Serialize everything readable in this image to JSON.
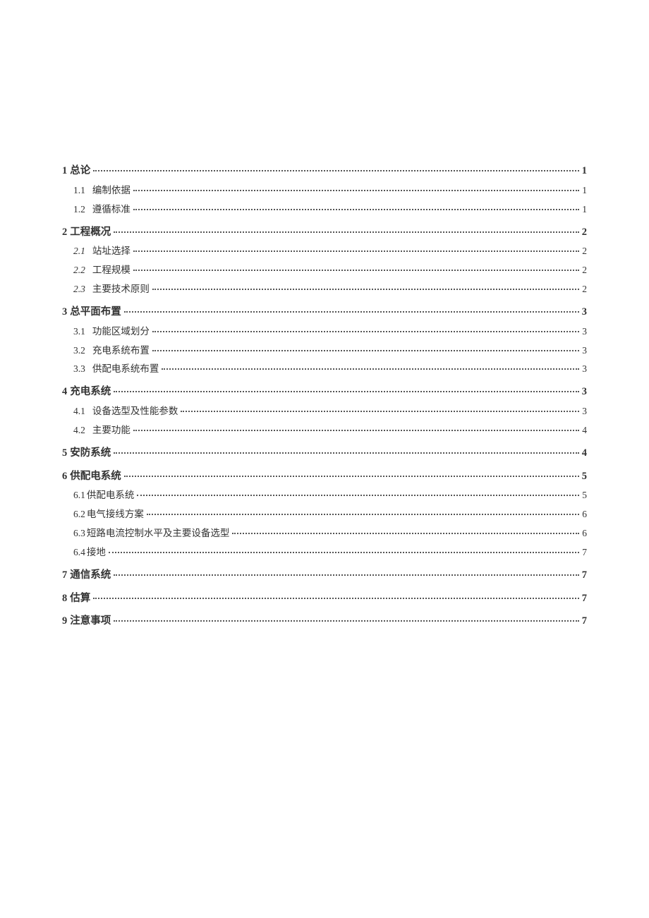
{
  "toc": [
    {
      "num": "1",
      "title": "总论",
      "page": "1",
      "level": 1,
      "children": [
        {
          "num": "1.1",
          "title": "编制依据",
          "page": "1",
          "level": 2
        },
        {
          "num": "1.2",
          "title": "遵循标准",
          "page": "1",
          "level": 2
        }
      ]
    },
    {
      "num": "2",
      "title": "工程概况",
      "page": "2",
      "level": 1,
      "children": [
        {
          "num": "2.1",
          "title": "站址选择",
          "page": "2",
          "level": 2,
          "italicNum": true
        },
        {
          "num": "2.2",
          "title": "工程规模",
          "page": "2",
          "level": 2,
          "italicNum": true
        },
        {
          "num": "2.3",
          "title": "主要技术原则",
          "page": "2",
          "level": 2,
          "italicNum": true
        }
      ]
    },
    {
      "num": "3",
      "title": "总平面布置",
      "page": "3",
      "level": 1,
      "children": [
        {
          "num": "3.1",
          "title": "功能区域划分",
          "page": "3",
          "level": 2
        },
        {
          "num": "3.2",
          "title": "充电系统布置",
          "page": "3",
          "level": 2
        },
        {
          "num": "3.3",
          "title": "供配电系统布置",
          "page": "3",
          "level": 2
        }
      ]
    },
    {
      "num": "4",
      "title": "充电系统",
      "page": "3",
      "level": 1,
      "children": [
        {
          "num": "4.1",
          "title": "设备选型及性能参数",
          "page": "3",
          "level": 2
        },
        {
          "num": "4.2",
          "title": "主要功能",
          "page": "4",
          "level": 2
        }
      ]
    },
    {
      "num": "5",
      "title": "安防系统",
      "page": "4",
      "level": 1,
      "children": []
    },
    {
      "num": "6",
      "title": "供配电系统",
      "page": "5",
      "level": 1,
      "children": [
        {
          "num": "6.1",
          "title": "供配电系统",
          "page": "5",
          "level": 2,
          "noGap": true
        },
        {
          "num": "6.2",
          "title": "电气接线方案",
          "page": "6",
          "level": 2,
          "noGap": true
        },
        {
          "num": "6.3",
          "title": "短路电流控制水平及主要设备选型",
          "page": "6",
          "level": 2,
          "noGap": true
        },
        {
          "num": "6.4",
          "title": "接地",
          "page": "7",
          "level": 2,
          "noGap": true
        }
      ]
    },
    {
      "num": "7",
      "title": "通信系统",
      "page": "7",
      "level": 1,
      "children": []
    },
    {
      "num": "8",
      "title": "估算",
      "page": "7",
      "level": 1,
      "children": []
    },
    {
      "num": "9",
      "title": "注意事项",
      "page": "7",
      "level": 1,
      "children": []
    }
  ]
}
